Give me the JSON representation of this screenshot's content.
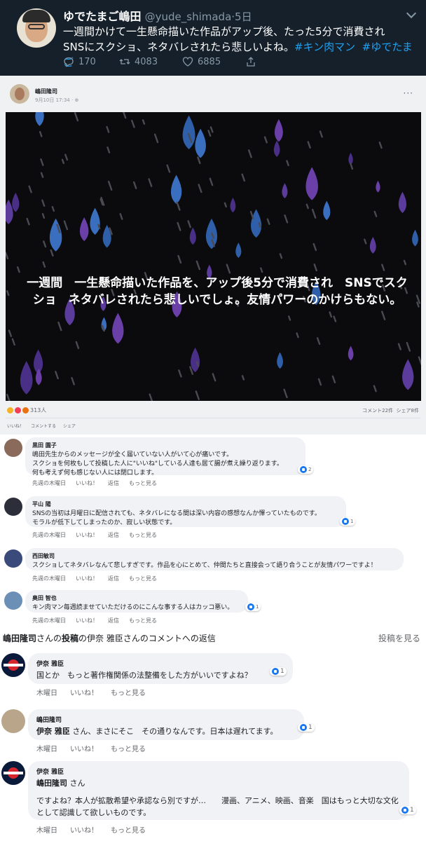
{
  "tweet": {
    "display_name": "ゆでたまご嶋田",
    "handle": "@yude_shimada",
    "time": "5日",
    "text_main": "一週間かけて一生懸命描いた作品がアップ後、たった5分で消費され　SNSにスクショ、ネタバレされたら悲しいよね。",
    "hashtag_1": "#キン肉マン",
    "hashtag_2": "#ゆでたまご",
    "replies": "170",
    "retweets": "4083",
    "likes": "6885",
    "colors": {
      "background": "#15202b",
      "link": "#1da1f2"
    }
  },
  "fb_post": {
    "author": "嶋田隆司",
    "date": "9月10日 17:34 · ",
    "more": "···",
    "image_text": "一週間　一生懸命描いた作品を、アップ後5分で消費され　SNSでスクショ　ネタバレされたら悲しいでしょ。友情パワーのかけらもない。",
    "reaction_count": "313人",
    "comment_count": "コメント22件",
    "share_count": "シェア8件",
    "actions": [
      "いいね！",
      "コメントする",
      "シェア"
    ]
  },
  "comments": [
    {
      "name": "黒田 園子",
      "text": "嶋田先生からのメッセージが全く届いていない人がいて心が痛いです。\nスクショを何枚もして投稿した人に\"いいね\"している人達も居て腸が煮え繰り返ります。\n何も考えず何も感じない人には閉口します。",
      "likes": "2",
      "meta": [
        "先週の木曜日",
        "いいね！",
        "返信",
        "もっと見る"
      ]
    },
    {
      "name": "平山 陽",
      "text": "SNSの当初は月曜日に配信されても、ネタバレになる間は深い内容の感想なんか憚っていたものです。\nモラルが低下してしまったのか、寂しい状態です。",
      "likes": "1",
      "meta": [
        "先週の木曜日",
        "いいね！",
        "返信",
        "もっと見る"
      ]
    },
    {
      "name": "西田敏司",
      "text": "スクショしてネタバレなんて悲しすぎです。作品を心にとめて、仲間たちと直接会って語り合うことが友情パワーですよ！",
      "likes": "",
      "meta": [
        "先週の木曜日",
        "いいね！",
        "返信",
        "もっと見る"
      ]
    },
    {
      "name": "奥田 智也",
      "text": "キン肉マン毎週読ませていただけるのにこんな事する人はカッコ悪い。",
      "likes": "1",
      "meta": [
        "先週の木曜日",
        "いいね！",
        "返信",
        "もっと見る"
      ]
    }
  ],
  "reply_header": {
    "part1": "嶋田隆司",
    "part2": "さんの",
    "part3": "投稿",
    "part4": "の伊奈 雅臣さんのコメントへの返信",
    "view_post": "投稿を見る"
  },
  "replies": [
    {
      "name": "伊奈 雅臣",
      "text": "国とか　もっと著作権関係の法整備をした方がいいですよね？",
      "mention": "",
      "likes": "1",
      "meta": [
        "木曜日",
        "いいね！",
        "もっと見る"
      ]
    },
    {
      "name": "嶋田隆司",
      "mention": "伊奈 雅臣",
      "text": " さん、まさにそこ　その通りなんです。日本は遅れてます。",
      "likes": "1",
      "meta": [
        "木曜日",
        "いいね！",
        "もっと見る"
      ]
    },
    {
      "name": "伊奈 雅臣",
      "mention": "嶋田隆司",
      "mention_suffix": " さん",
      "text": "ですよね？本人が拡散希望や承認なら別ですが…　　漫画、アニメ、映画、音楽　国はもっと大切な文化として認識して欲しいものです。",
      "likes": "1",
      "meta": [
        "木曜日",
        "いいね！",
        "もっと見る"
      ]
    }
  ]
}
